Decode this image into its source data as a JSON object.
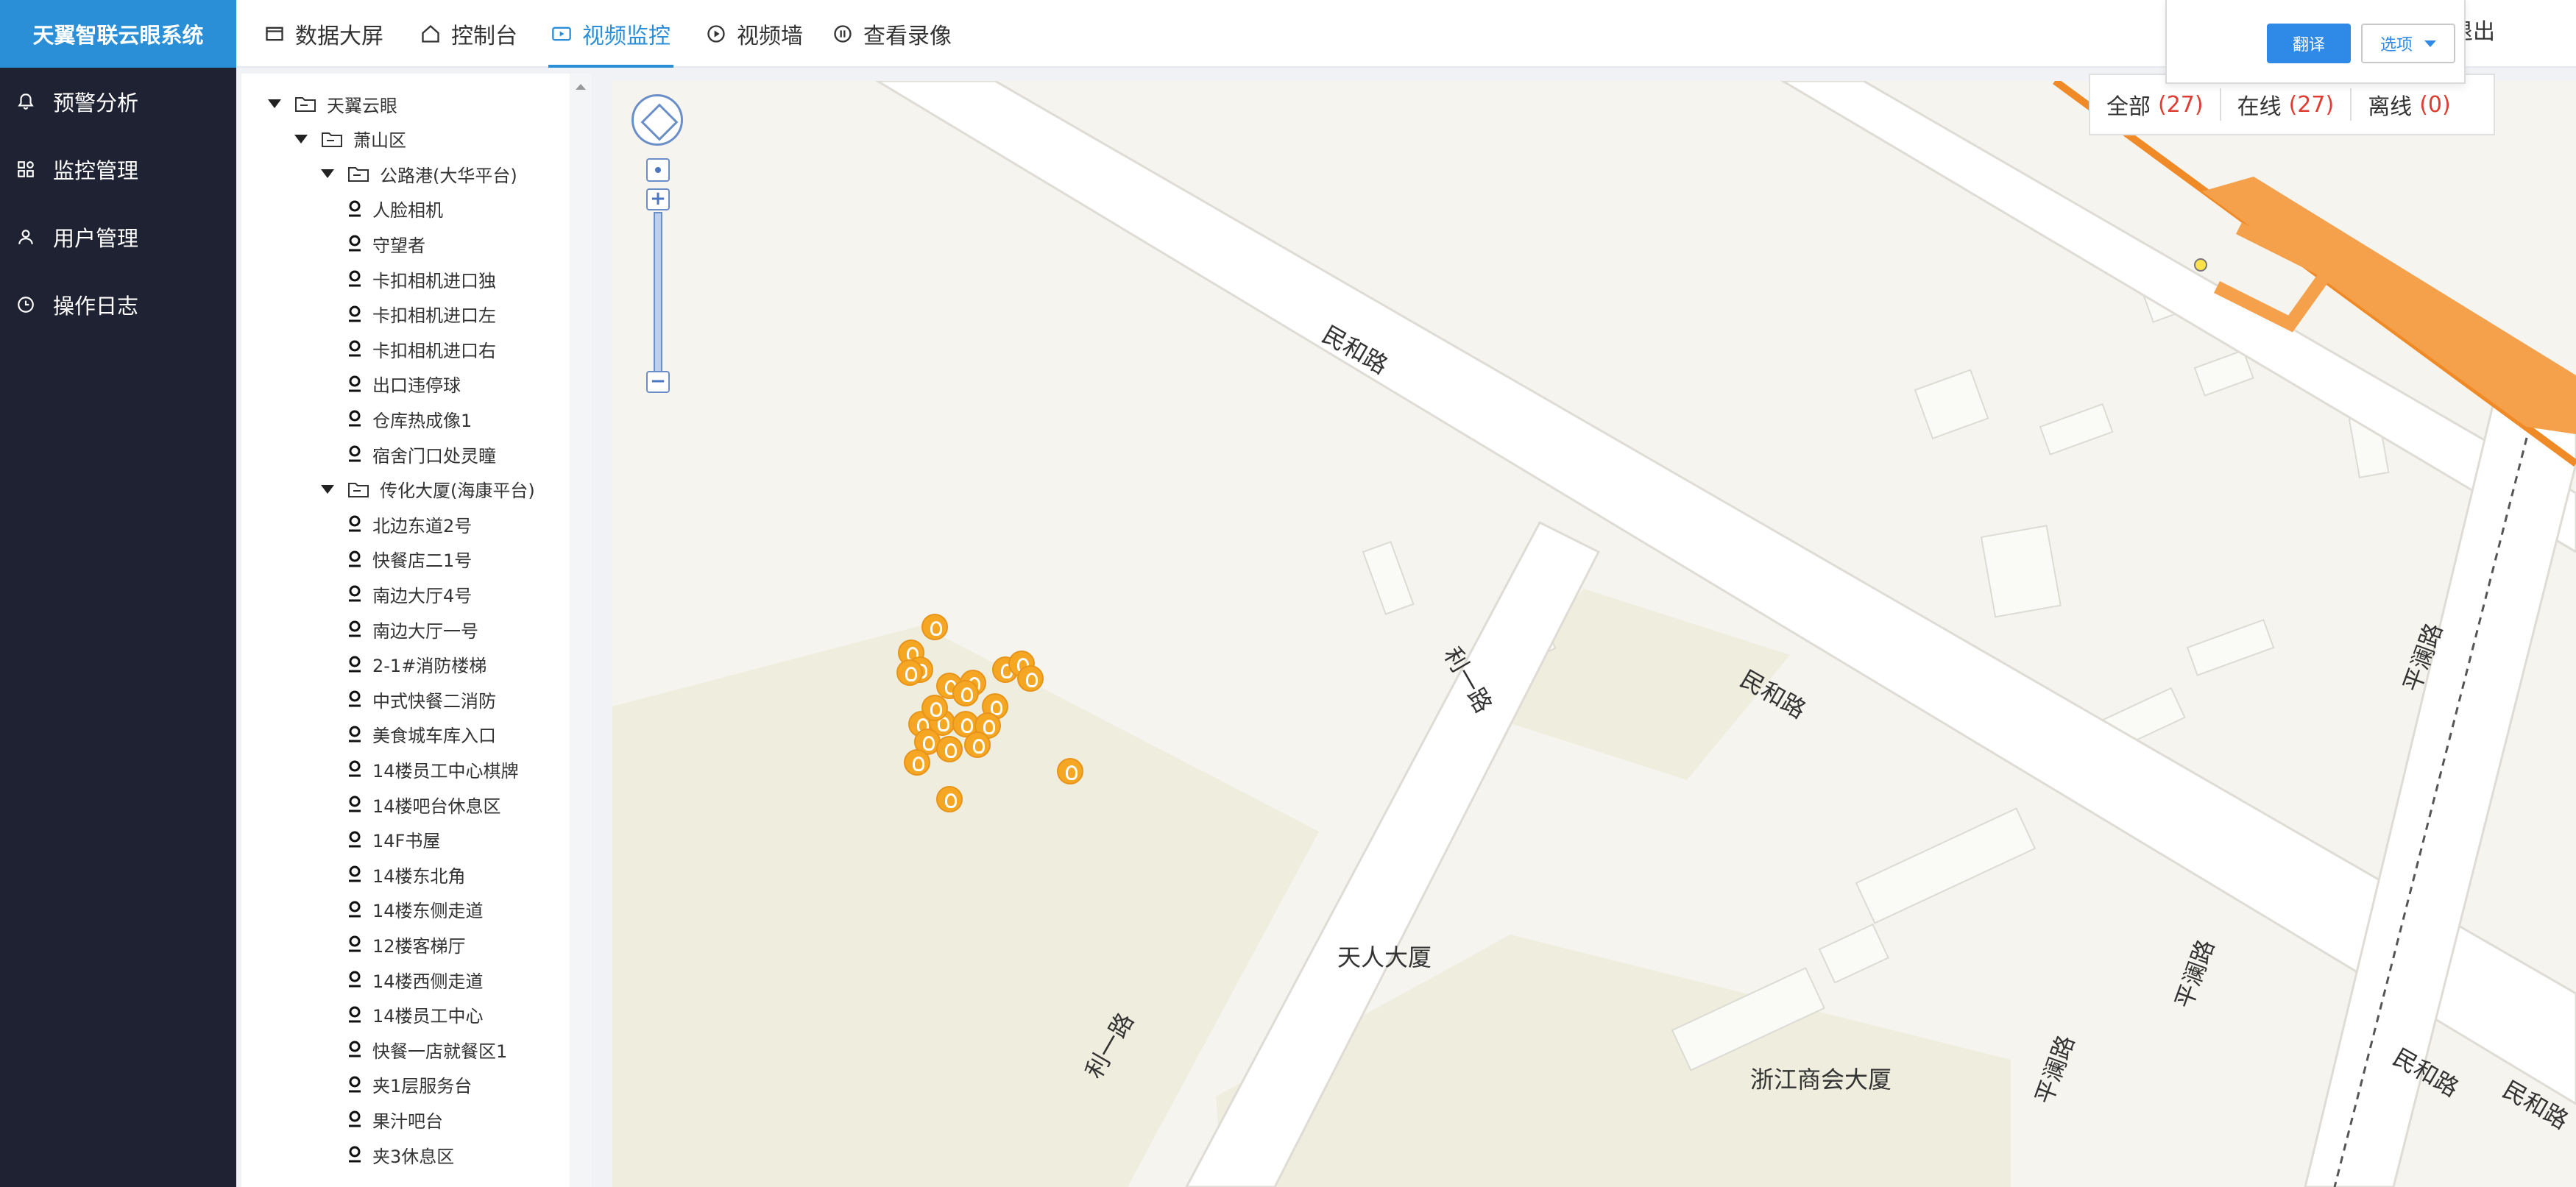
{
  "app": {
    "title": "天翼智联云眼系统"
  },
  "nav": {
    "items": [
      {
        "label": "预警分析",
        "icon": "bell-icon"
      },
      {
        "label": "监控管理",
        "icon": "apps-icon"
      },
      {
        "label": "用户管理",
        "icon": "user-icon"
      },
      {
        "label": "操作日志",
        "icon": "clock-icon"
      }
    ]
  },
  "tabs": [
    {
      "label": "数据大屏",
      "icon": "screen-icon"
    },
    {
      "label": "控制台",
      "icon": "home-icon"
    },
    {
      "label": "视频监控",
      "icon": "video-icon",
      "active": true
    },
    {
      "label": "视频墙",
      "icon": "play-icon"
    },
    {
      "label": "查看录像",
      "icon": "pause-icon"
    }
  ],
  "header": {
    "logout": "退出"
  },
  "popup": {
    "translate": "翻译",
    "options": "选项"
  },
  "stats": {
    "all_label": "全部",
    "all_count": "(27)",
    "online_label": "在线",
    "online_count": "(27)",
    "offline_label": "离线",
    "offline_count": "(0)"
  },
  "tree": {
    "root": "天翼云眼",
    "district": "萧山区",
    "group1": "公路港(大华平台)",
    "group1_items": [
      "人脸相机",
      "守望者",
      "卡扣相机进口独",
      "卡扣相机进口左",
      "卡扣相机进口右",
      "出口违停球",
      "仓库热成像1",
      "宿舍门口处灵瞳"
    ],
    "group2": "传化大厦(海康平台)",
    "group2_items": [
      "北边东道2号",
      "快餐店二1号",
      "南边大厅4号",
      "南边大厅一号",
      "2-1#消防楼梯",
      "中式快餐二消防",
      "美食城车库入口",
      "14楼员工中心棋牌",
      "14楼吧台休息区",
      "14F书屋",
      "14楼东北角",
      "14楼东侧走道",
      "12楼客梯厅",
      "14楼西侧走道",
      "14楼员工中心",
      "快餐一店就餐区1",
      "夹1层服务台",
      "果汁吧台",
      "夹3休息区"
    ]
  },
  "map": {
    "labels": [
      "民和路",
      "民和路",
      "民和路",
      "民和路",
      "利一路",
      "利一路",
      "平澜路",
      "平澜路",
      "平澜路",
      "天人大厦",
      "浙江商会大厦"
    ],
    "camera_count": 27
  },
  "colors": {
    "brand": "#2b8fd8",
    "nav_bg": "#1f2233",
    "marker": "#f5a623",
    "count_red": "#e03c31"
  }
}
